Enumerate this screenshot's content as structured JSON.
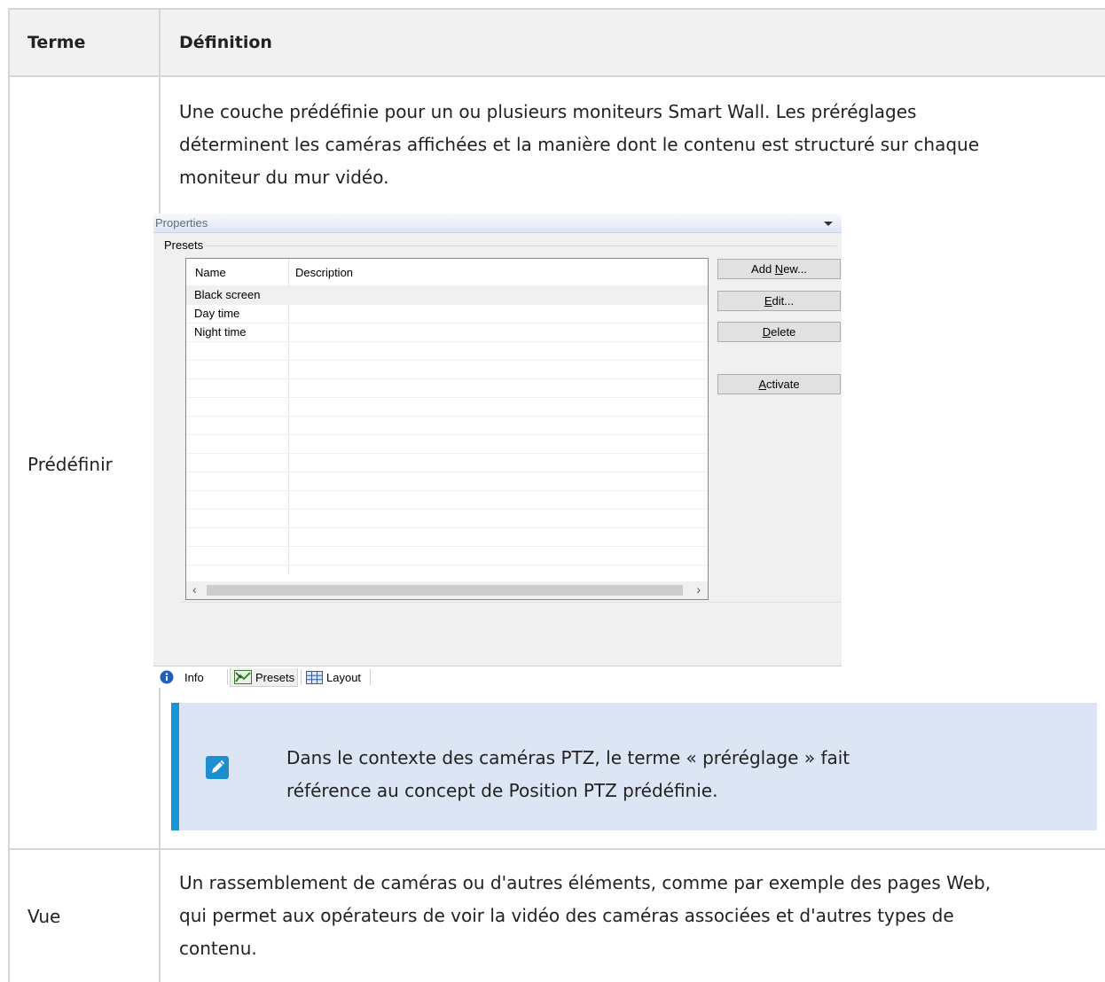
{
  "table": {
    "headers": [
      "Terme",
      "Définition"
    ],
    "rows": [
      {
        "term": "Prédéfinir",
        "definition_lines": [
          "Une couche prédéfinie pour un ou plusieurs moniteurs Smart Wall. Les préréglages",
          "déterminent les caméras affichées et la manière dont le contenu est structuré sur chaque",
          "moniteur du mur vidéo."
        ]
      },
      {
        "term": "Vue",
        "definition_lines": [
          "Un rassemblement de caméras ou d'autres éléments, comme par exemple des pages Web,",
          "qui permet aux opérateurs de voir la vidéo des caméras associées et d'autres types de",
          "contenu."
        ]
      }
    ]
  },
  "panel": {
    "title": "Properties",
    "group_label": "Presets",
    "columns": [
      "Name",
      "Description"
    ],
    "items": [
      {
        "name": "Black screen",
        "description": ""
      },
      {
        "name": "Day time",
        "description": ""
      },
      {
        "name": "Night time",
        "description": ""
      }
    ],
    "buttons": {
      "add_new": {
        "prefix": "Add ",
        "mnemonic": "N",
        "suffix": "ew..."
      },
      "edit": {
        "prefix": "",
        "mnemonic": "E",
        "suffix": "dit..."
      },
      "delete": {
        "prefix": "",
        "mnemonic": "D",
        "suffix": "elete"
      },
      "activate": {
        "prefix": "",
        "mnemonic": "A",
        "suffix": "ctivate"
      }
    },
    "tabs": [
      "Info",
      "Presets",
      "Layout"
    ]
  },
  "note": {
    "lines": [
      "Dans le contexte des caméras PTZ, le terme « préréglage » fait",
      "référence au concept de Position PTZ prédéfinie."
    ]
  },
  "colors": {
    "note_accent": "#1896d3",
    "note_background": "#dce5f3",
    "header_background": "#f1f1f1"
  }
}
